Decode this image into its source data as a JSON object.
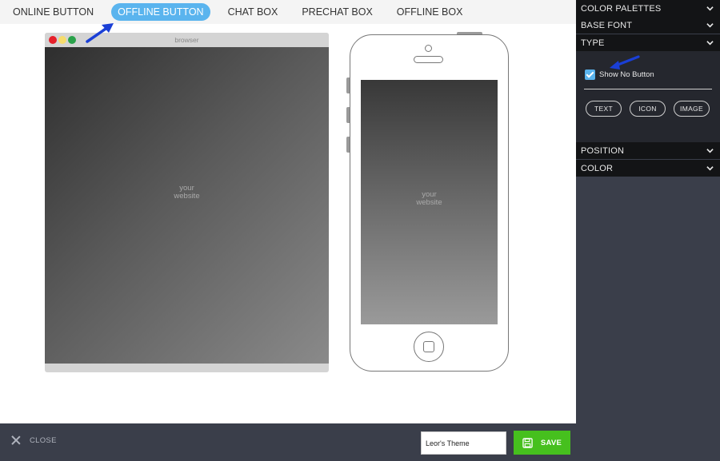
{
  "tabs": [
    {
      "label": "ONLINE BUTTON"
    },
    {
      "label": "OFFLINE BUTTON"
    },
    {
      "label": "CHAT BOX"
    },
    {
      "label": "PRECHAT BOX"
    },
    {
      "label": "OFFLINE BOX"
    }
  ],
  "preview": {
    "browser_title": "browser",
    "website_line1": "your",
    "website_line2": "website"
  },
  "bottom_bar": {
    "close_label": "CLOSE",
    "theme_name_value": "Leor's Theme",
    "save_label": "SAVE"
  },
  "panel": {
    "sections": [
      {
        "label": "COLOR PALETTES"
      },
      {
        "label": "BASE FONT"
      },
      {
        "label": "TYPE"
      },
      {
        "label": "POSITION"
      },
      {
        "label": "COLOR"
      }
    ],
    "type": {
      "show_no_button_label": "Show No Button",
      "show_no_button_checked": true,
      "options": [
        {
          "label": "TEXT"
        },
        {
          "label": "ICON"
        },
        {
          "label": "IMAGE"
        }
      ]
    }
  },
  "colors": {
    "active_tab": "#5ab4ee",
    "save_green": "#46c01e",
    "panel_dark": "#131416",
    "bottom_bar": "#3a3e4a",
    "annotation_arrow": "#1a3fd6"
  }
}
